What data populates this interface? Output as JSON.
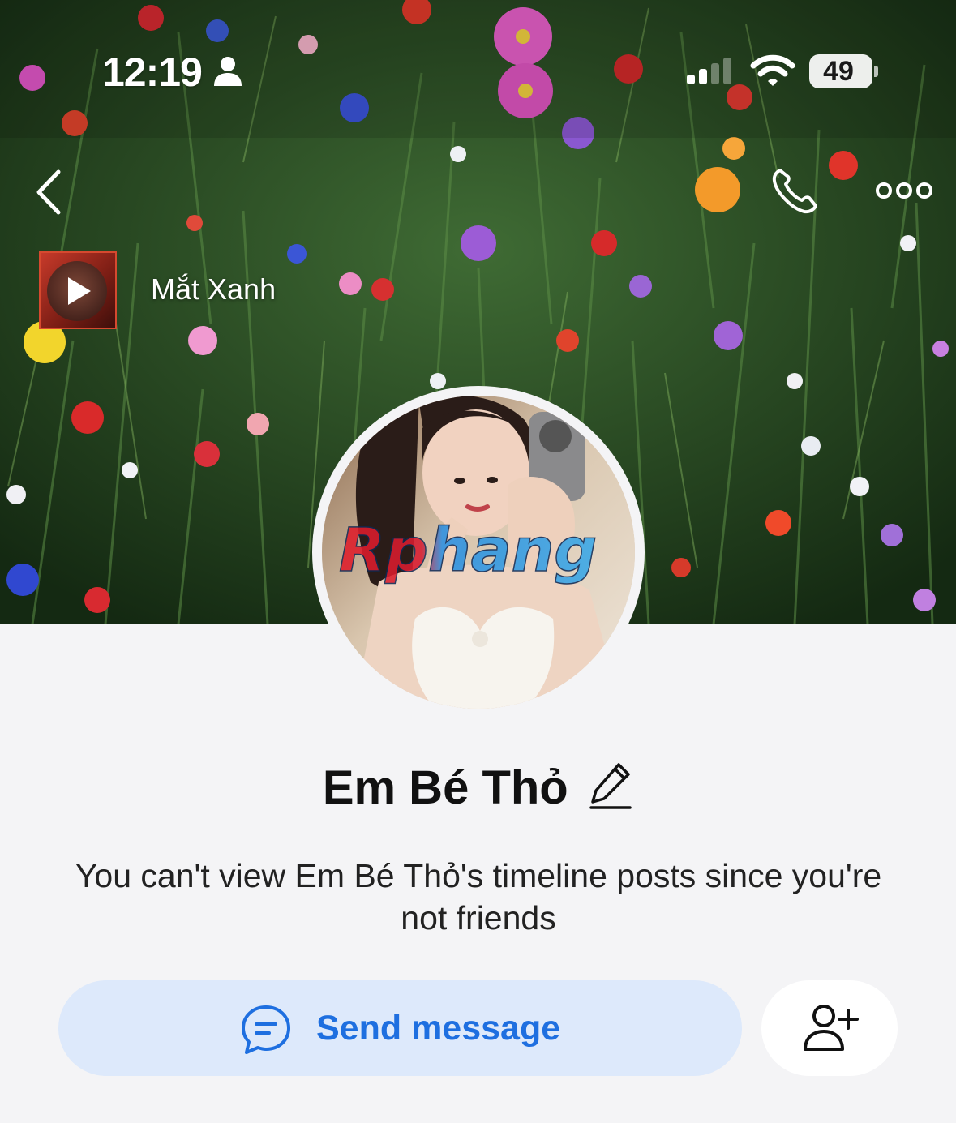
{
  "status_bar": {
    "time": "12:19",
    "battery": "49"
  },
  "cover": {
    "music_title": "Mắt Xanh"
  },
  "avatar": {
    "watermark": "Rphang"
  },
  "profile": {
    "name": "Em Bé Thỏ",
    "notice": "You can't view Em Bé Thỏ's timeline posts since you're not friends"
  },
  "actions": {
    "send_message_label": "Send message"
  },
  "icons": {
    "person": "person-icon",
    "signal": "cellular-signal-icon",
    "wifi": "wifi-icon",
    "back": "chevron-left-icon",
    "call": "phone-icon",
    "more": "more-dots-icon",
    "play": "play-icon",
    "edit": "pencil-icon",
    "message": "chat-bubble-icon",
    "add_friend": "add-friend-icon"
  },
  "colors": {
    "accent": "#1e6fe0",
    "send_button_bg": "#dde9fb",
    "page_bg": "#f4f4f6"
  }
}
